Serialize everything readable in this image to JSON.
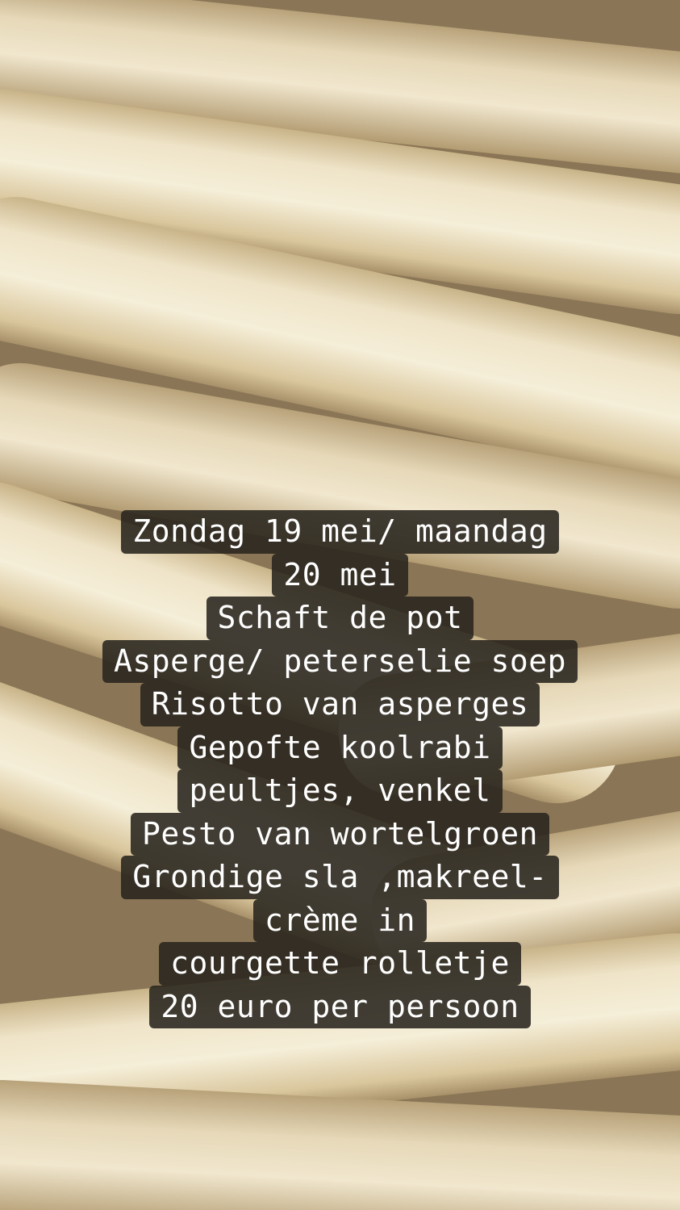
{
  "story": {
    "lines": [
      "Zondag 19 mei/ maandag",
      "20 mei",
      "Schaft de pot",
      "Asperge/ peterselie soep",
      "Risotto van asperges",
      "Gepofte koolrabi",
      "peultjes, venkel",
      "Pesto van wortelgroen",
      "Grondige sla ,makreel-",
      "crème in",
      "courgette rolletje",
      "20 euro per persoon"
    ]
  },
  "colors": {
    "text": "#ffffff",
    "caption_background": "#28241e",
    "asparagus": "#e8dcc0"
  }
}
